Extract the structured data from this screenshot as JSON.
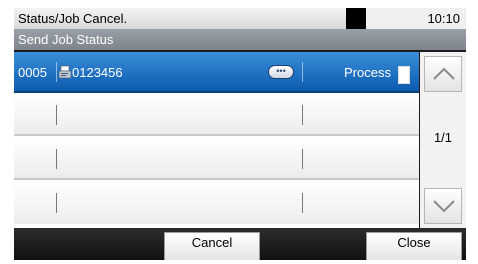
{
  "header": {
    "title": "Status/Job Cancel.",
    "time": "10:10"
  },
  "subheader": {
    "title": "Send Job Status"
  },
  "rows": [
    {
      "job_no": "0005",
      "destination": "0123456",
      "status": "Process",
      "dest_icon": "fax-icon",
      "detail_icon": "dots-icon",
      "doc_icon": "document-icon"
    }
  ],
  "pager": {
    "page": "1/1",
    "up_icon": "chevron-up-icon",
    "down_icon": "chevron-down-icon"
  },
  "buttons": {
    "cancel": "Cancel",
    "close": "Close"
  },
  "colors": {
    "selected_row": "#1a6cc4",
    "background": "#1c1c1c",
    "button_face": "#f0f0f0"
  }
}
